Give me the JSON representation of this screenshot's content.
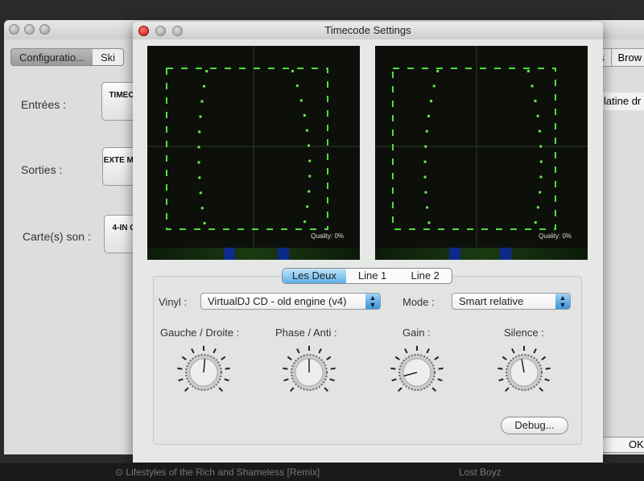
{
  "background_window": {
    "tabs": [
      "Configuratio...",
      "Ski",
      "s",
      "Brow"
    ],
    "rows": [
      {
        "label": "Entrées :",
        "button": "TIMEC"
      },
      {
        "label": "Sorties :",
        "button": "EXTE MIX"
      },
      {
        "label": "Carte(s) son :",
        "button": "4-IN C"
      }
    ],
    "right_field": "latine dr",
    "ok_label": "OK"
  },
  "dialog": {
    "title": "Timecode Settings",
    "scopes": [
      {
        "quality": "Quality: 0%"
      },
      {
        "quality": "Quality: 0%"
      }
    ],
    "tabs": [
      {
        "label": "Les Deux",
        "selected": true
      },
      {
        "label": "Line 1"
      },
      {
        "label": "Line 2"
      }
    ],
    "vinyl_label": "Vinyl :",
    "vinyl_value": "VirtualDJ CD - old engine (v4)",
    "mode_label": "Mode :",
    "mode_value": "Smart relative",
    "knobs": [
      {
        "label": "Gauche / Droite :",
        "angle": 5
      },
      {
        "label": "Phase / Anti :",
        "angle": 0
      },
      {
        "label": "Gain :",
        "angle": -105
      },
      {
        "label": "Silence :",
        "angle": -10
      }
    ],
    "debug_label": "Debug..."
  },
  "bottom_bar": {
    "track": "⊙ Lifestyles of the Rich and Shameless [Remix]",
    "artist": "Lost Boyz"
  }
}
